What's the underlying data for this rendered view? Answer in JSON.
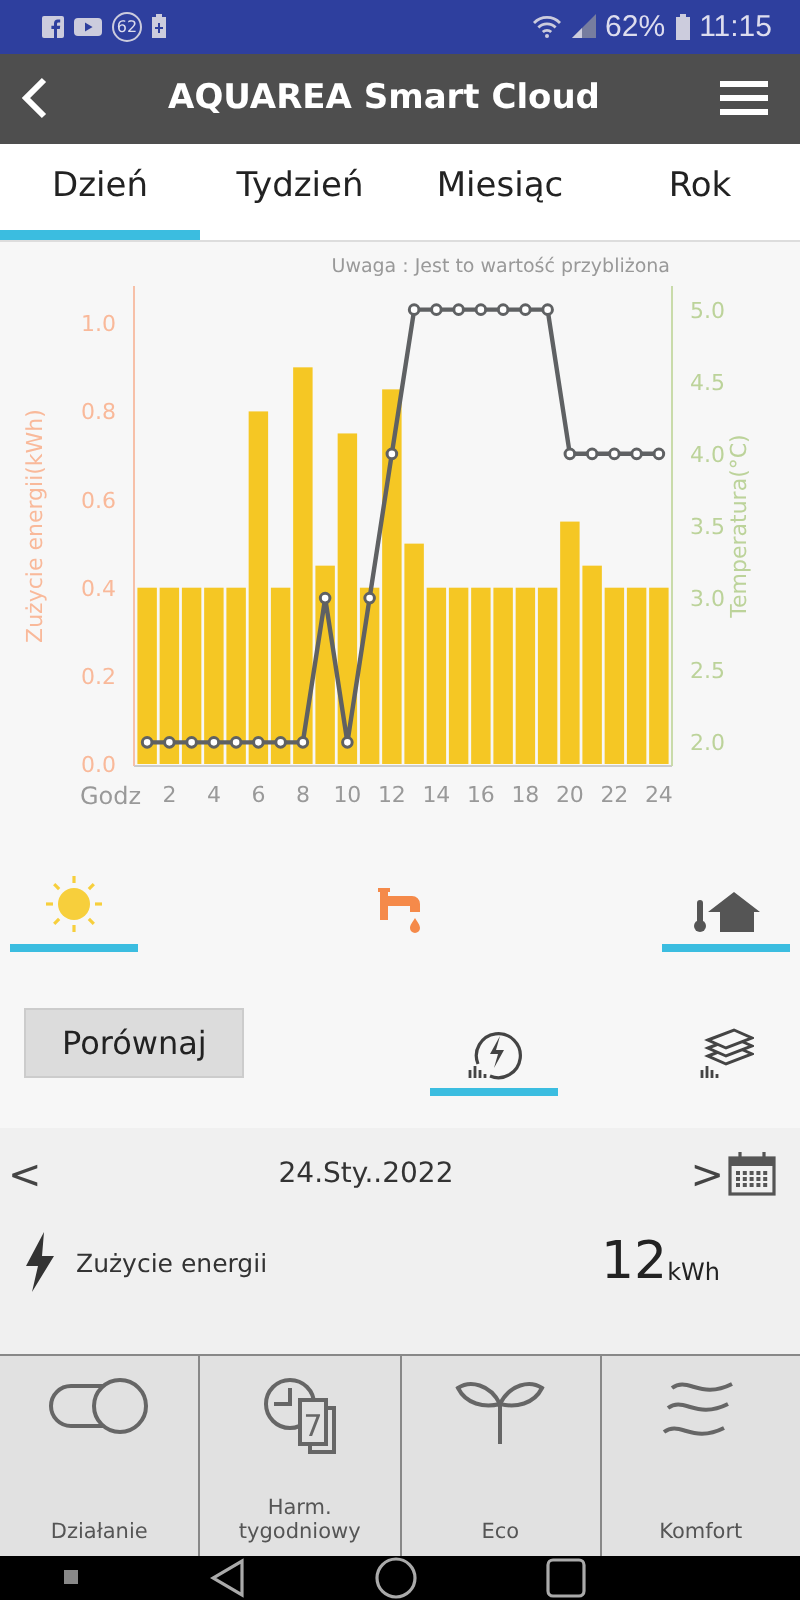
{
  "status_bar": {
    "notification_count": "62",
    "battery": "62%",
    "time": "11:15"
  },
  "app_bar": {
    "title": "AQUAREA Smart Cloud"
  },
  "tabs": [
    {
      "label": "Dzień",
      "selected": true
    },
    {
      "label": "Tydzień",
      "selected": false
    },
    {
      "label": "Miesiąc",
      "selected": false
    },
    {
      "label": "Rok",
      "selected": false
    }
  ],
  "chart": {
    "note": "Uwaga : Jest to wartość przybliżona",
    "energy": {
      "chart_data": {
        "type": "bar",
        "xlabel": "Godz",
        "ylabel": "Zużycie energii(kWh)",
        "x": [
          1,
          2,
          3,
          4,
          5,
          6,
          7,
          8,
          9,
          10,
          11,
          12,
          13,
          14,
          15,
          16,
          17,
          18,
          19,
          20,
          21,
          22,
          23,
          24
        ],
        "xlim": [
          0.5,
          24.5
        ],
        "xticks": [
          2,
          4,
          6,
          8,
          10,
          12,
          14,
          16,
          18,
          20,
          22,
          24
        ],
        "ylim": [
          0,
          1.08
        ],
        "yticks": [
          {
            "value": 0,
            "label": "0.0"
          },
          {
            "value": 0.2,
            "label": "0.2"
          },
          {
            "value": 0.4,
            "label": "0.4"
          },
          {
            "value": 0.6,
            "label": "0.6"
          },
          {
            "value": 0.8,
            "label": "0.8"
          },
          {
            "value": 1,
            "label": "1.0"
          }
        ],
        "series": [
          {
            "color": "#f5c724",
            "values": [
              0.4,
              0.4,
              0.4,
              0.4,
              0.4,
              0.8,
              0.4,
              0.9,
              0.45,
              0.75,
              0.4,
              0.85,
              0.5,
              0.4,
              0.4,
              0.4,
              0.4,
              0.4,
              0.4,
              0.55,
              0.45,
              0.4,
              0.4,
              0.4
            ]
          }
        ]
      }
    },
    "temperature": {
      "chart_data": {
        "type": "line",
        "ylabel": "Temperatura(°C)",
        "x": [
          1,
          2,
          3,
          4,
          5,
          6,
          7,
          8,
          9,
          10,
          11,
          12,
          13,
          14,
          15,
          16,
          17,
          18,
          19,
          20,
          21,
          22,
          23,
          24
        ],
        "xlim": [
          0.5,
          24.5
        ],
        "ylim": [
          1.85,
          5.15
        ],
        "yticks": [
          {
            "value": 2,
            "label": "2.0"
          },
          {
            "value": 2.5,
            "label": "2.5"
          },
          {
            "value": 3,
            "label": "3.0"
          },
          {
            "value": 3.5,
            "label": "3.5"
          },
          {
            "value": 4,
            "label": "4.0"
          },
          {
            "value": 4.5,
            "label": "4.5"
          },
          {
            "value": 5,
            "label": "5.0"
          }
        ],
        "series": [
          {
            "color": "#5f6163",
            "marker": true,
            "values": [
              2,
              2,
              2,
              2,
              2,
              2,
              2,
              2,
              3,
              2,
              3,
              4,
              5,
              5,
              5,
              5,
              5,
              5,
              5,
              4,
              4,
              4,
              4,
              4
            ]
          }
        ]
      }
    }
  },
  "categories": [
    {
      "kind": "sun",
      "selected": true
    },
    {
      "kind": "tap",
      "selected": false
    },
    {
      "kind": "house",
      "selected": true
    }
  ],
  "compare_button": "Porównaj",
  "views": [
    {
      "kind": "energy",
      "selected": true
    },
    {
      "kind": "layers",
      "selected": false
    }
  ],
  "date_nav": {
    "prev": "<",
    "date": "24.Sty..2022",
    "next": ">"
  },
  "summary": {
    "label": "Zużycie energii",
    "value": "12",
    "unit": "kWh"
  },
  "bottom_nav": [
    {
      "kind": "toggle",
      "label": "Działanie"
    },
    {
      "kind": "schedule",
      "label": "Harm.\ntygodniowy",
      "badge": "7"
    },
    {
      "kind": "eco",
      "label": "Eco"
    },
    {
      "kind": "comfort",
      "label": "Komfort"
    }
  ]
}
